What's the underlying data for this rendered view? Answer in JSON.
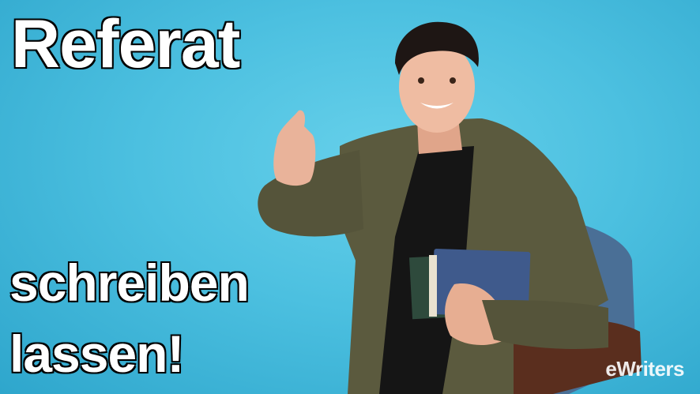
{
  "headline": {
    "line1": "Referat",
    "line2": "schreiben",
    "line3": "lassen!"
  },
  "logo": {
    "text": "eWriters"
  },
  "colors": {
    "background": "#4cc0e0",
    "text": "#ffffff",
    "text_outline": "#111111",
    "jacket": "#5b5a3e",
    "book": "#3f5a8c"
  }
}
